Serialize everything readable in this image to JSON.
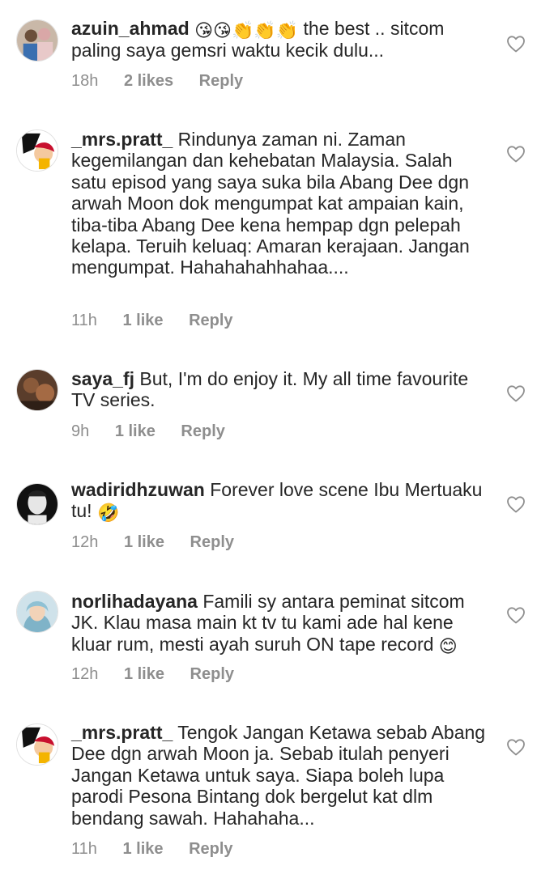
{
  "comments": [
    {
      "username": "azuin_ahmad",
      "emojis": "😘😘👏👏👏",
      "text": "the best .. sitcom paling saya gemsri waktu kecik dulu...",
      "time": "18h",
      "likes": "2 likes",
      "reply": "Reply"
    },
    {
      "username": "_mrs.pratt_",
      "text": "Rindunya zaman ni. Zaman kegemilangan dan kehebatan Malaysia. Salah satu episod yang saya suka bila Abang Dee dgn arwah Moon dok mengumpat kat ampaian kain, tiba-tiba Abang Dee kena hempap dgn pelepah kelapa. Teruih keluaq: Amaran kerajaan. Jangan mengumpat. Hahahahahhahaa....",
      "time": "11h",
      "likes": "1 like",
      "reply": "Reply"
    },
    {
      "username": "saya_fj",
      "text": "But, I'm do enjoy it. My all time favourite TV series.",
      "time": "9h",
      "likes": "1 like",
      "reply": "Reply"
    },
    {
      "username": "wadiridhzuwan",
      "text": "Forever love scene Ibu Mertuaku tu!",
      "emoji_after": "🤣",
      "time": "12h",
      "likes": "1 like",
      "reply": "Reply"
    },
    {
      "username": "norlihadayana",
      "text": "Famili sy antara peminat sitcom JK. Klau masa main kt tv tu kami ade hal kene kluar rum, mesti ayah suruh ON tape record",
      "emoji_after": "😊",
      "time": "12h",
      "likes": "1 like",
      "reply": "Reply"
    },
    {
      "username": "_mrs.pratt_",
      "text": "Tengok Jangan Ketawa sebab Abang Dee dgn arwah Moon ja. Sebab itulah penyeri Jangan Ketawa untuk saya. Siapa boleh lupa parodi Pesona Bintang dok bergelut kat dlm bendang sawah. Hahahaha...",
      "time": "11h",
      "likes": "1 like",
      "reply": "Reply"
    }
  ],
  "icons": {
    "like": "heart-outline-icon",
    "avatar": "avatar-photo"
  },
  "colors": {
    "text": "#262626",
    "meta": "#8e8e8e",
    "heart": "#8e8e8e",
    "background": "#ffffff"
  }
}
